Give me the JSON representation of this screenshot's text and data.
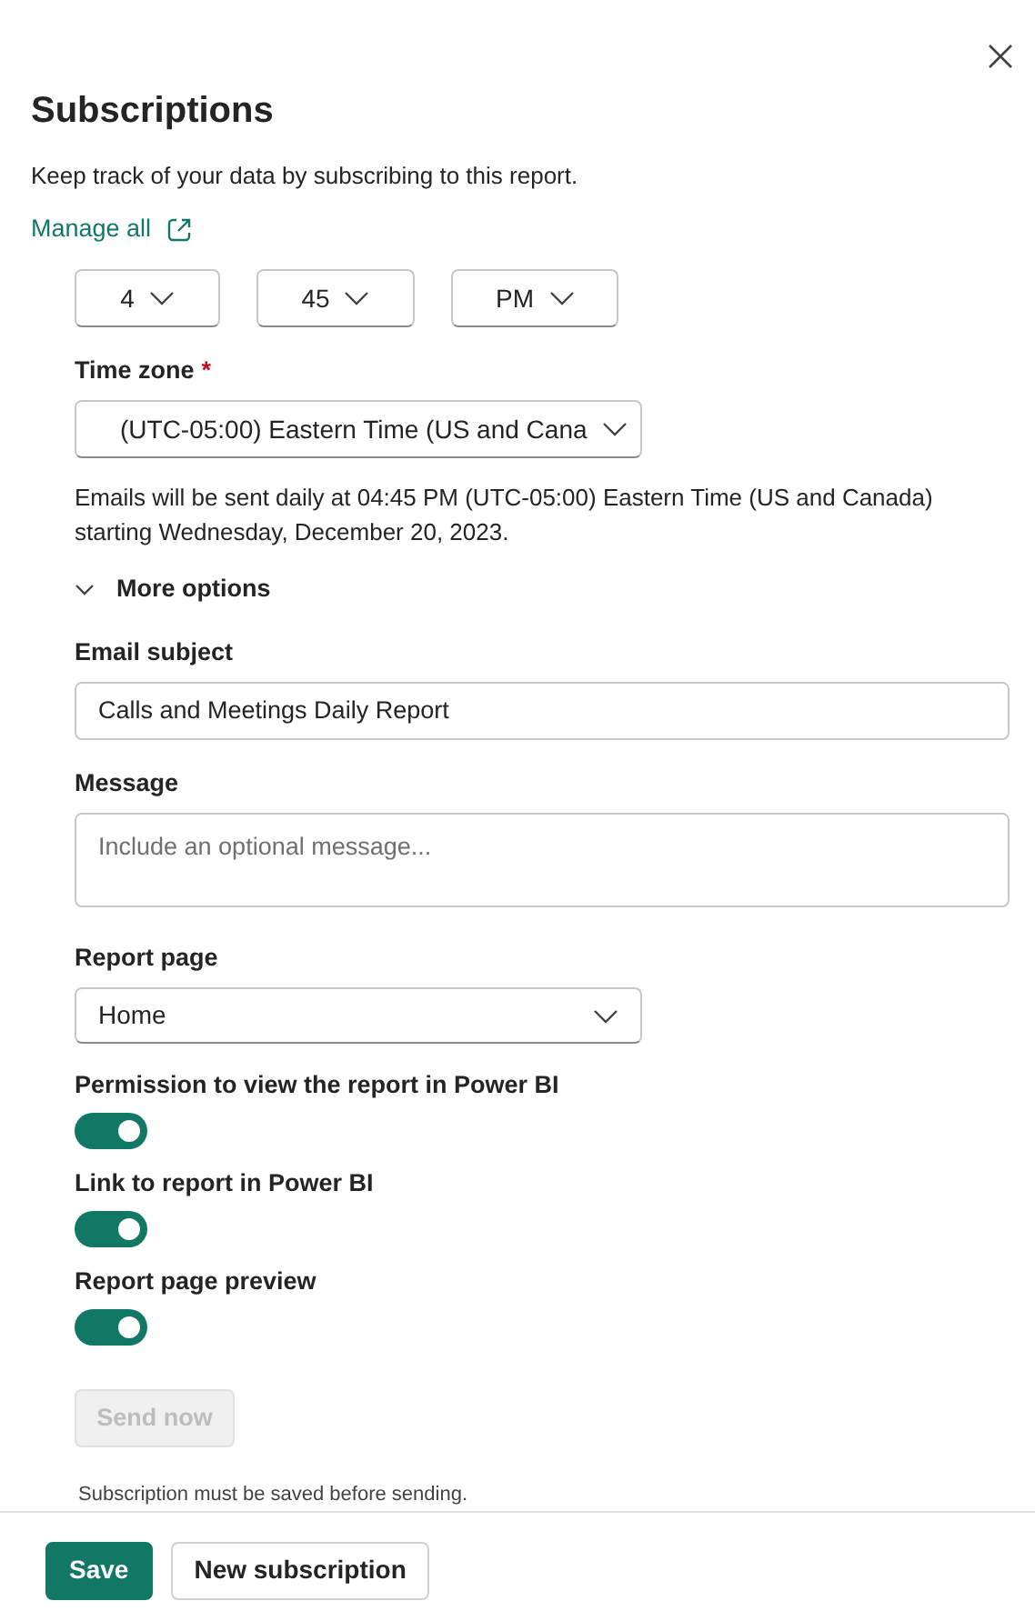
{
  "title": "Subscriptions",
  "description": "Keep track of your data by subscribing to this report.",
  "manage_link": "Manage all",
  "time": [
    {
      "value": "4"
    },
    {
      "value": "45"
    },
    {
      "value": "PM"
    }
  ],
  "time_zone": {
    "label": "Time zone",
    "required_mark": "*",
    "value": "(UTC-05:00) Eastern Time (US and Cana"
  },
  "schedule_note": "Emails will be sent daily at 04:45 PM (UTC-05:00) Eastern Time (US and Canada) starting Wednesday, December 20, 2023.",
  "more_options": {
    "label": "More options",
    "expanded": true
  },
  "email_subject": {
    "label": "Email subject",
    "value": "Calls and Meetings Daily Report"
  },
  "message": {
    "label": "Message",
    "placeholder": "Include an optional message..."
  },
  "report_page": {
    "label": "Report page",
    "value": "Home"
  },
  "toggles": [
    {
      "label": "Permission to view the report in Power BI",
      "on": true
    },
    {
      "label": "Link to report in Power BI",
      "on": true
    },
    {
      "label": "Report page preview",
      "on": true
    }
  ],
  "send_now": {
    "label": "Send now",
    "disabled": true
  },
  "send_note": "Subscription must be saved before sending.",
  "footer_buttons": [
    {
      "label": "Save",
      "kind": "primary"
    },
    {
      "label": "New subscription",
      "kind": "secondary"
    }
  ]
}
